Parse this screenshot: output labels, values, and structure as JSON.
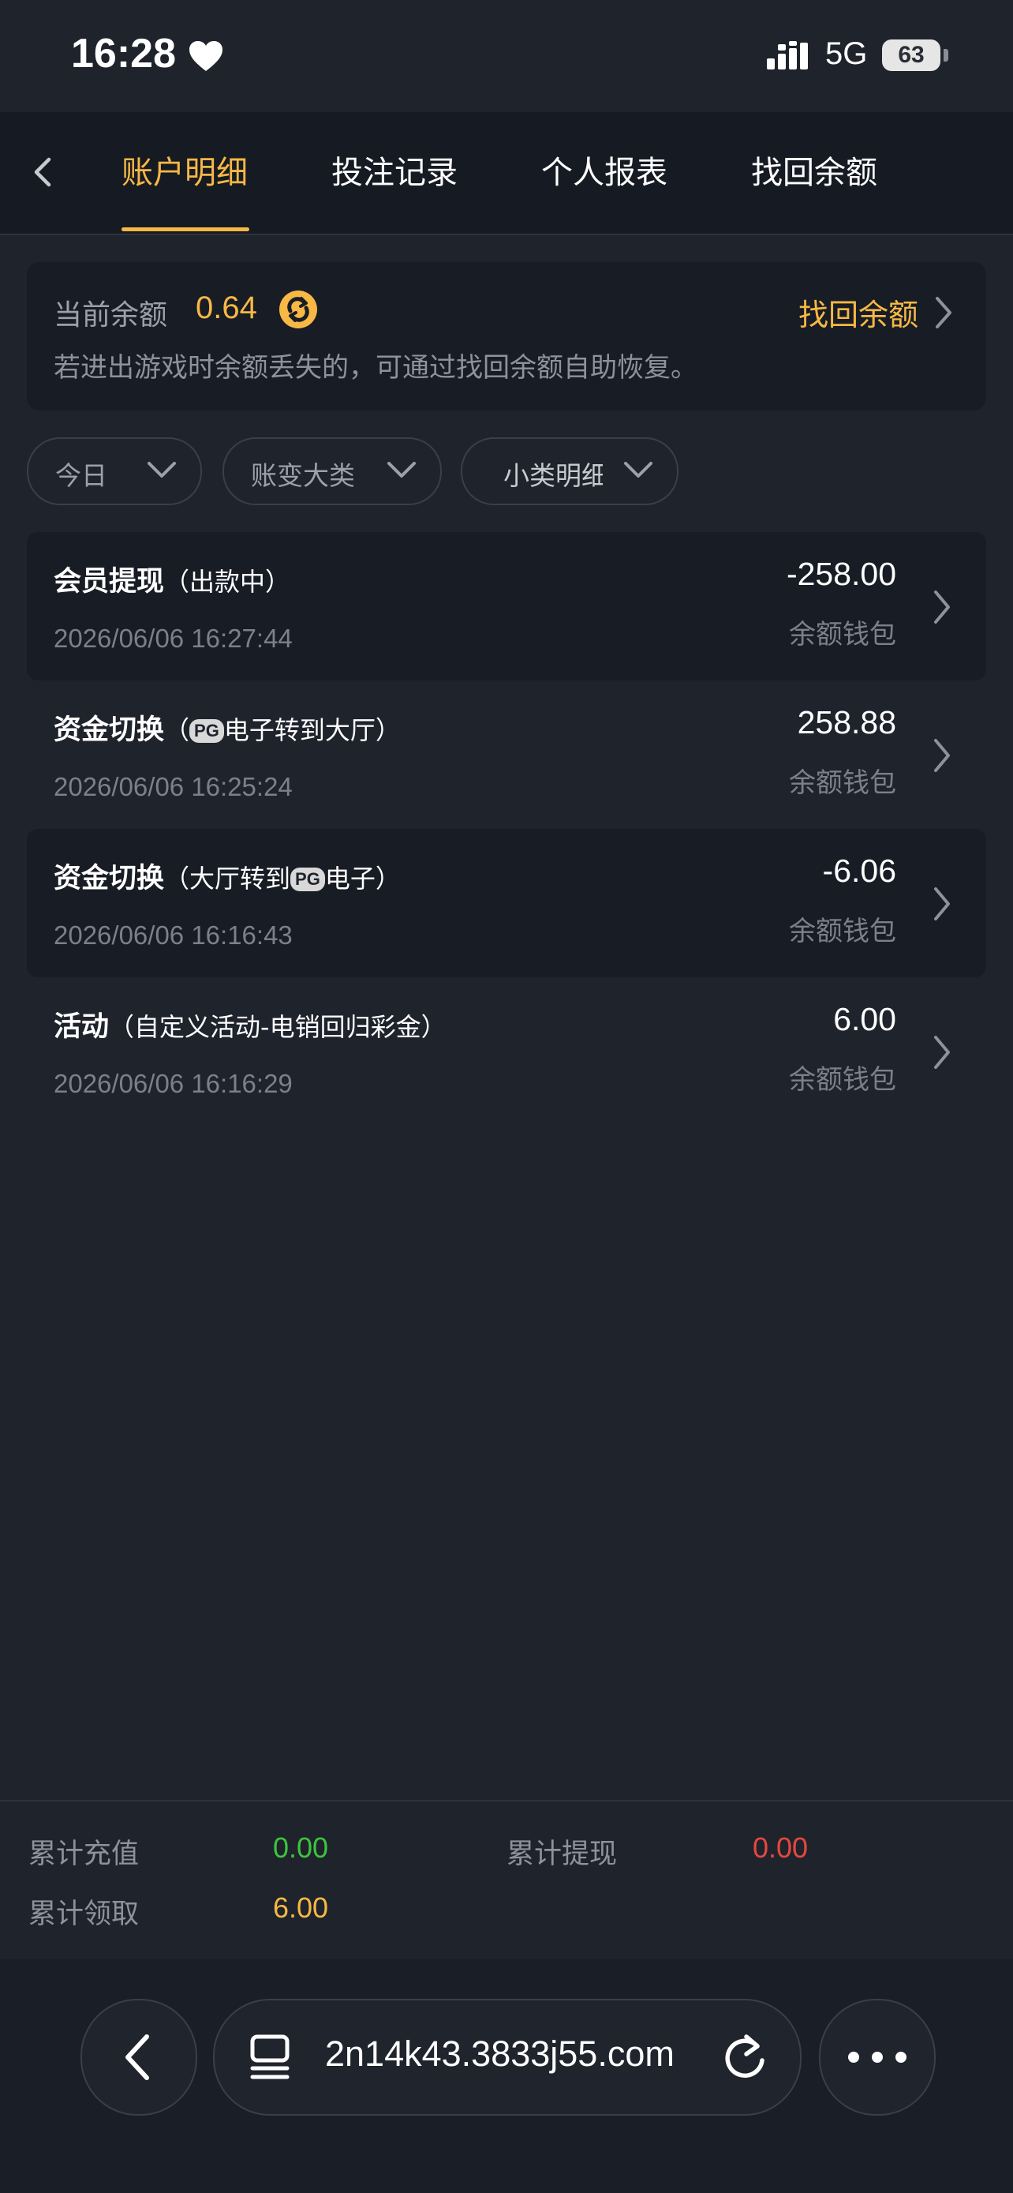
{
  "status_bar": {
    "time": "16:28",
    "network": "5G",
    "battery": "63"
  },
  "nav": {
    "tabs": [
      {
        "label": "账户明细",
        "active": true
      },
      {
        "label": "投注记录",
        "active": false
      },
      {
        "label": "个人报表",
        "active": false
      },
      {
        "label": "找回余额",
        "active": false
      }
    ]
  },
  "balance": {
    "label": "当前余额",
    "value": "0.64",
    "recover_label": "找回余额",
    "tip": "若进出游戏时余额丢失的，可通过找回余额自助恢复。"
  },
  "filters": {
    "date": "今日",
    "category": "账变大类",
    "subcategory": "小类明细"
  },
  "records": [
    {
      "title": "会员提现",
      "detail": "（出款中）",
      "time": "2026/06/06 16:27:44",
      "amount": "-258.00",
      "wallet": "余额钱包"
    },
    {
      "title": "资金切换",
      "detail_pre": "（",
      "badge": "PG",
      "detail_post": "电子转到大厅）",
      "time": "2026/06/06 16:25:24",
      "amount": "258.88",
      "wallet": "余额钱包"
    },
    {
      "title": "资金切换",
      "detail_pre": "（大厅转到",
      "badge": "PG",
      "detail_post": "电子）",
      "time": "2026/06/06 16:16:43",
      "amount": "-6.06",
      "wallet": "余额钱包"
    },
    {
      "title": "活动",
      "detail": "（自定义活动-电销回归彩金）",
      "time": "2026/06/06 16:16:29",
      "amount": "6.00",
      "wallet": "余额钱包"
    }
  ],
  "summary": {
    "deposit_label": "累计充值",
    "deposit_value": "0.00",
    "withdraw_label": "累计提现",
    "withdraw_value": "0.00",
    "claim_label": "累计领取",
    "claim_value": "6.00",
    "colors": {
      "deposit": "#3ec43e",
      "withdraw": "#e5483e",
      "claim": "#f7b846"
    }
  },
  "browser": {
    "url": "2n14k43.3833j55.com"
  }
}
